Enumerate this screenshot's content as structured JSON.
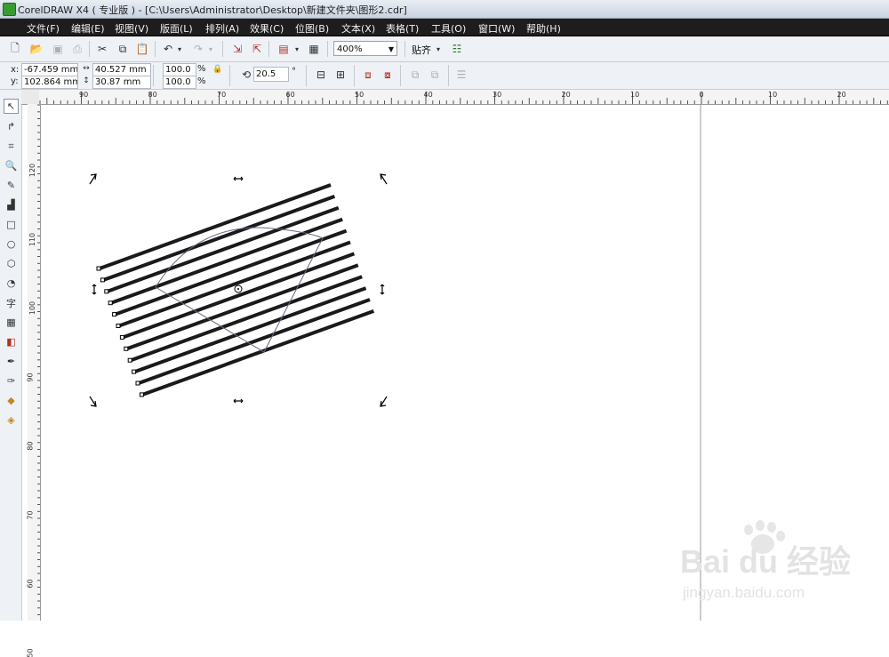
{
  "window": {
    "title": "CorelDRAW X4 ( 专业版 ) - [C:\\Users\\Administrator\\Desktop\\新建文件夹\\图形2.cdr]"
  },
  "menu": [
    "文件(F)",
    "编辑(E)",
    "视图(V)",
    "版面(L)",
    "排列(A)",
    "效果(C)",
    "位图(B)",
    "文本(X)",
    "表格(T)",
    "工具(O)",
    "窗口(W)",
    "帮助(H)"
  ],
  "toolbar": {
    "zoom": "400%",
    "snap_label": "贴齐"
  },
  "properties": {
    "x_label": "x:",
    "x_value": "-67.459 mm",
    "y_label": "y:",
    "y_value": "102.864 mm",
    "width_value": "40.527 mm",
    "height_value": "30.87 mm",
    "scale_x": "100.0",
    "scale_y": "100.0",
    "percent": "%",
    "rotation": "20.5",
    "degree": "°"
  },
  "ruler": {
    "unit": "mm",
    "top_ticks": [
      "90",
      "80",
      "70",
      "60",
      "50",
      "40",
      "30",
      "20",
      "10",
      "0",
      "10",
      "20",
      "30"
    ],
    "left_ticks": [
      "120",
      "110",
      "100",
      "90",
      "80",
      "70",
      "60",
      "50"
    ]
  },
  "watermark": {
    "brand": "Bai du 经验",
    "url": "jingyan.baidu.com"
  },
  "colors": {
    "menubar": "#1d1d1d",
    "stripes": "#1a1a1a",
    "outline": "#6b6580"
  }
}
